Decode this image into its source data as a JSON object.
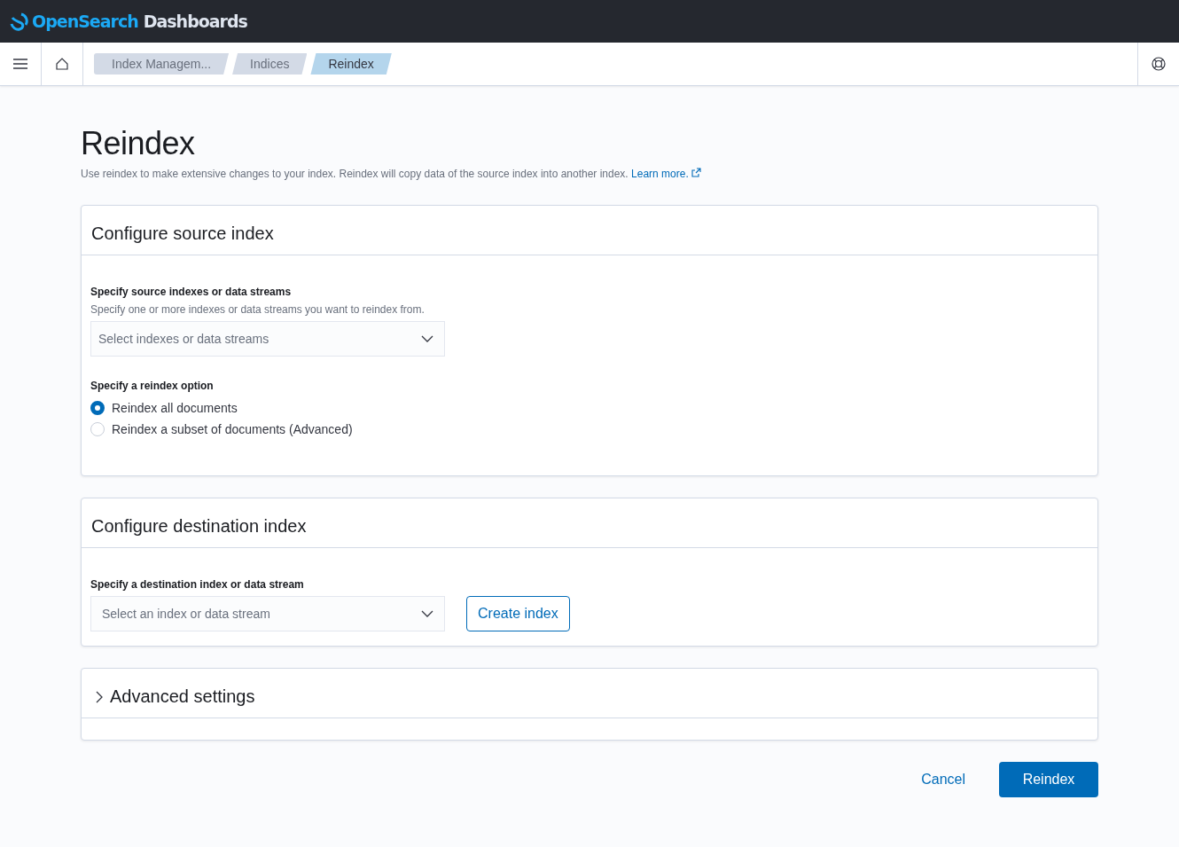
{
  "header": {
    "logo_primary": "OpenSearch",
    "logo_secondary": "Dashboards"
  },
  "breadcrumbs": [
    {
      "label": "Index Managem...",
      "selected": false
    },
    {
      "label": "Indices",
      "selected": false
    },
    {
      "label": "Reindex",
      "selected": true
    }
  ],
  "page": {
    "title": "Reindex",
    "description": "Use reindex to make extensive changes to your index. Reindex will copy data of the source index into another index.",
    "link": "Learn more."
  },
  "source_panel": {
    "title": "Configure source index",
    "field_label": "Specify source indexes or data streams",
    "field_help": "Specify one or more indexes or data streams you want to reindex from.",
    "field_placeholder": "Select indexes or data streams",
    "option_label": "Specify a reindex option",
    "options": [
      {
        "label": "Reindex all documents",
        "selected": true
      },
      {
        "label": "Reindex a subset of documents (Advanced)",
        "selected": false
      }
    ]
  },
  "destination_panel": {
    "title": "Configure destination index",
    "field_label": "Specify a destination index or data stream",
    "field_placeholder": "Select an index or data stream",
    "button": "Create index"
  },
  "advanced_panel": {
    "title": "Advanced settings",
    "expanded": false
  },
  "actions": {
    "cancel": "Cancel",
    "submit": "Reindex"
  }
}
